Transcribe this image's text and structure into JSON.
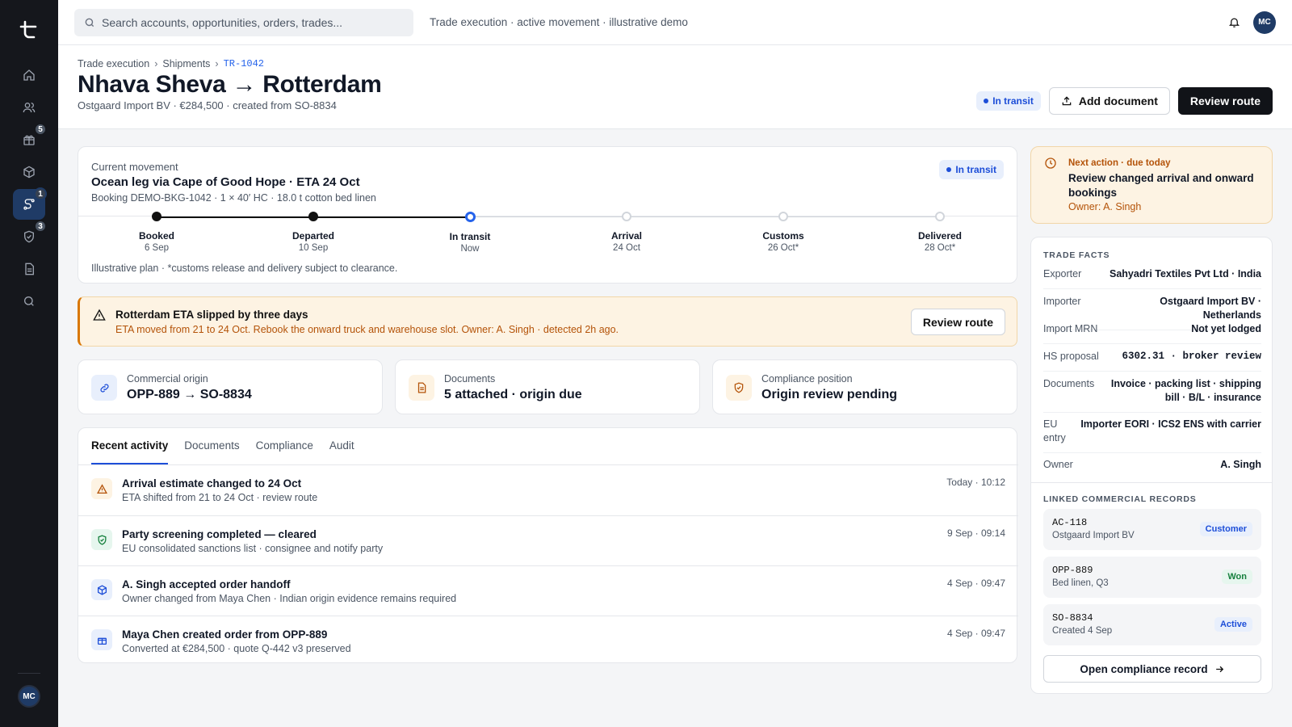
{
  "app": {
    "user_initials": "MC"
  },
  "sidebar": {
    "items": [
      {
        "icon": "home-icon",
        "badge": ""
      },
      {
        "icon": "users-icon",
        "badge": ""
      },
      {
        "icon": "gift-icon",
        "badge": "5"
      },
      {
        "icon": "box-icon",
        "badge": ""
      },
      {
        "icon": "route-icon",
        "badge": "1"
      },
      {
        "icon": "shield-check-icon",
        "badge": "3"
      },
      {
        "icon": "document-icon",
        "badge": ""
      },
      {
        "icon": "search-icon",
        "badge": ""
      }
    ]
  },
  "topbar": {
    "search_placeholder": "Search accounts, opportunities, orders, trades...",
    "context": "Trade execution · active movement · illustrative demo"
  },
  "header": {
    "breadcrumb": [
      "Trade execution",
      "Shipments",
      "TR-1042"
    ],
    "title": "Nhava Sheva → Rotterdam",
    "subtitle": "Ostgaard Import BV · €284,500 · created from SO-8834",
    "status": "In transit",
    "add_document": "Add document",
    "review_route": "Review route"
  },
  "movement": {
    "label": "Current movement",
    "title": "Ocean leg via Cape of Good Hope · ETA 24 Oct",
    "meta": "Booking DEMO-BKG-1042 · 1 × 40′ HC · 18.0 t cotton bed linen",
    "status": "In transit",
    "steps": [
      {
        "name": "Booked",
        "date": "6 Sep",
        "state": "done"
      },
      {
        "name": "Departed",
        "date": "10 Sep",
        "state": "done"
      },
      {
        "name": "In transit",
        "date": "Now",
        "state": "current"
      },
      {
        "name": "Arrival",
        "date": "24 Oct",
        "state": "pending"
      },
      {
        "name": "Customs",
        "date": "26 Oct*",
        "state": "pending"
      },
      {
        "name": "Delivered",
        "date": "28 Oct*",
        "state": "pending"
      }
    ],
    "footnote": "Illustrative plan · *customs release and delivery subject to clearance."
  },
  "alert": {
    "title": "Rotterdam ETA slipped by three days",
    "text": "ETA moved from 21 to 24 Oct. Rebook the onward truck and warehouse slot. Owner: A. Singh · detected 2h ago.",
    "button": "Review route"
  },
  "stats": [
    {
      "label": "Commercial origin",
      "value": "OPP-889 → SO-8834"
    },
    {
      "label": "Documents",
      "value": "5 attached · origin due"
    },
    {
      "label": "Compliance position",
      "value": "Origin review pending"
    }
  ],
  "activity": {
    "tabs": [
      "Recent activity",
      "Documents",
      "Compliance",
      "Audit"
    ],
    "rows": [
      {
        "title": "Arrival estimate changed to 24 Oct",
        "sub": "ETA shifted from 21 to 24 Oct · review route",
        "time": "Today · 10:12"
      },
      {
        "title": "Party screening completed — cleared",
        "sub": "EU consolidated sanctions list · consignee and notify party",
        "time": "9 Sep · 09:14"
      },
      {
        "title": "A. Singh accepted order handoff",
        "sub": "Owner changed from Maya Chen · Indian origin evidence remains required",
        "time": "4 Sep · 09:47"
      },
      {
        "title": "Maya Chen created order from OPP-889",
        "sub": "Converted at €284,500 · quote Q-442 v3 preserved",
        "time": "4 Sep · 09:47"
      }
    ]
  },
  "next_action": {
    "label": "Next action · due today",
    "title": "Review changed arrival and onward bookings",
    "owner": "Owner: A. Singh"
  },
  "facts": {
    "heading": "TRADE FACTS",
    "rows": [
      {
        "k": "Exporter",
        "v": "Sahyadri Textiles Pvt Ltd · India"
      },
      {
        "k": "Importer",
        "v": "Ostgaard Import BV · Netherlands"
      },
      {
        "k": "Import MRN",
        "v": "Not yet lodged"
      },
      {
        "k": "HS proposal",
        "v": "6302.31 · broker review"
      },
      {
        "k": "Documents",
        "v": "Invoice · packing list · shipping bill · B/L · insurance"
      },
      {
        "k": "EU entry",
        "v": "Importer EORI · ICS2 ENS with carrier"
      },
      {
        "k": "Owner",
        "v": "A. Singh"
      }
    ],
    "linked_heading": "LINKED COMMERCIAL RECORDS",
    "linked": [
      {
        "id": "AC-118",
        "name": "Ostgaard Import BV",
        "badge": "Customer"
      },
      {
        "id": "OPP-889",
        "name": "Bed linen, Q3",
        "badge": "Won"
      },
      {
        "id": "SO-8834",
        "name": "Created 4 Sep",
        "badge": "Active"
      }
    ],
    "open_button": "Open compliance record"
  }
}
